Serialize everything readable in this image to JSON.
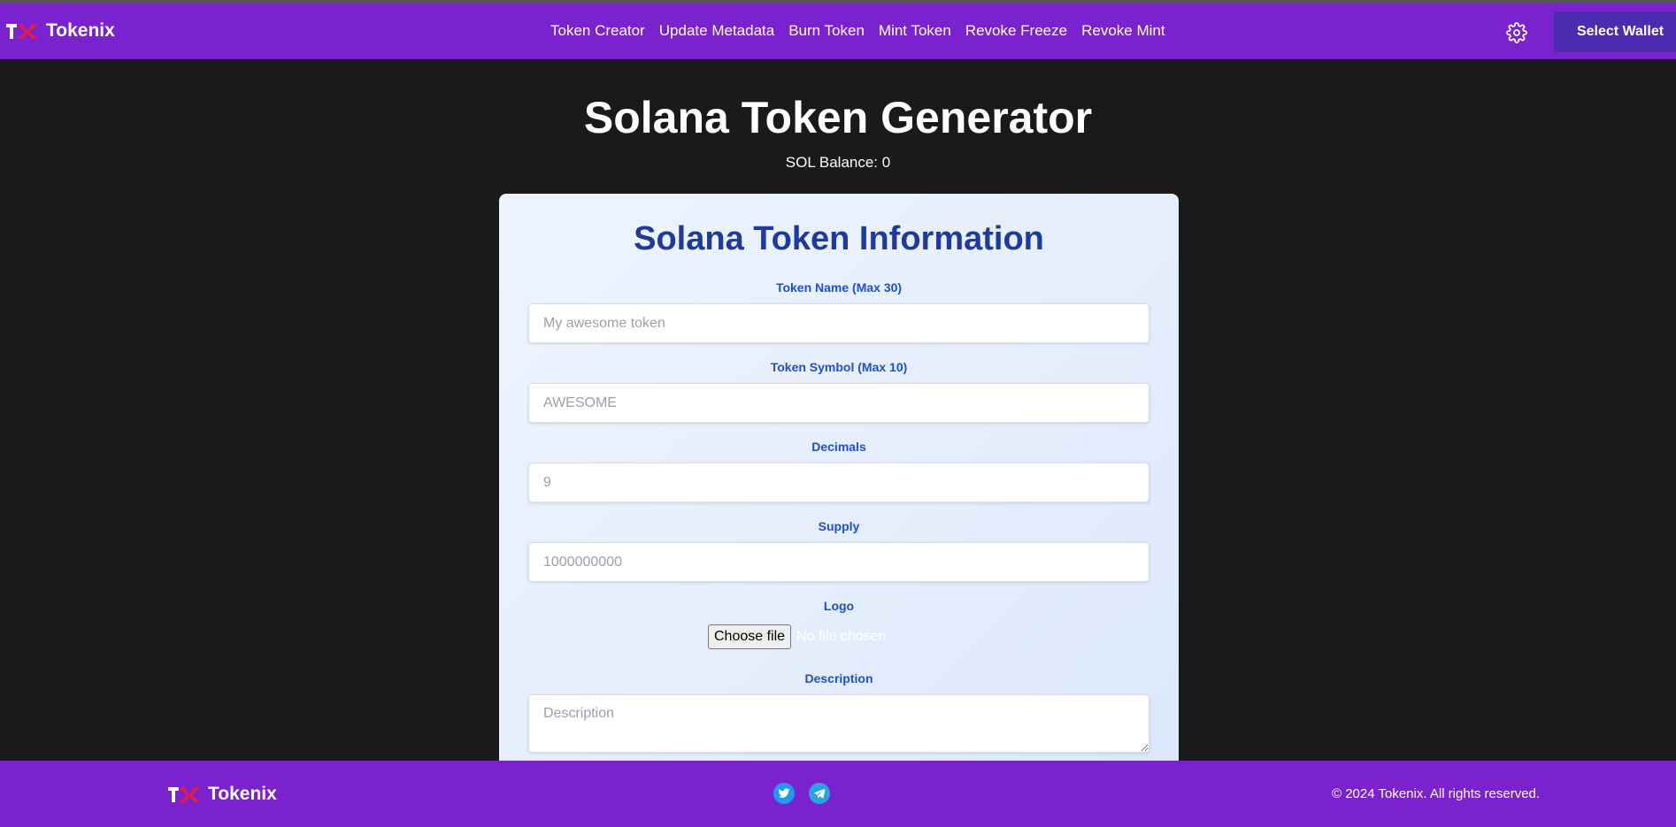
{
  "brand": {
    "name": "Tokenix",
    "accent": "#e11d48",
    "logo_icon": "tokenix-logo-icon"
  },
  "nav": {
    "links": [
      "Token Creator",
      "Update Metadata",
      "Burn Token",
      "Mint Token",
      "Revoke Freeze",
      "Revoke Mint"
    ],
    "settings_icon": "gear-icon",
    "wallet_button": "Select Wallet"
  },
  "hero": {
    "title": "Solana Token Generator",
    "balance": "SOL Balance: 0"
  },
  "form": {
    "title": "Solana Token Information",
    "token_name": {
      "label": "Token Name (Max 30)",
      "placeholder": "My awesome token",
      "value": ""
    },
    "token_symbol": {
      "label": "Token Symbol (Max 10)",
      "placeholder": "AWESOME",
      "value": ""
    },
    "decimals": {
      "label": "Decimals",
      "placeholder": "9",
      "value": ""
    },
    "supply": {
      "label": "Supply",
      "placeholder": "1000000000",
      "value": ""
    },
    "logo": {
      "label": "Logo",
      "button": "Choose file",
      "status": "No file chosen"
    },
    "description": {
      "label": "Description",
      "placeholder": "Description",
      "value": ""
    }
  },
  "footer": {
    "brand": "Tokenix",
    "social_icons": [
      "twitter-icon",
      "telegram-icon"
    ],
    "copyright": "© 2024 Tokenix. All rights reserved."
  },
  "colors": {
    "nav_bg": "#7b22cf",
    "wallet_bg": "#4c2bb0",
    "page_bg": "#1a1a1a",
    "form_title": "#1e3a9e",
    "form_label": "#1d4ed8"
  }
}
